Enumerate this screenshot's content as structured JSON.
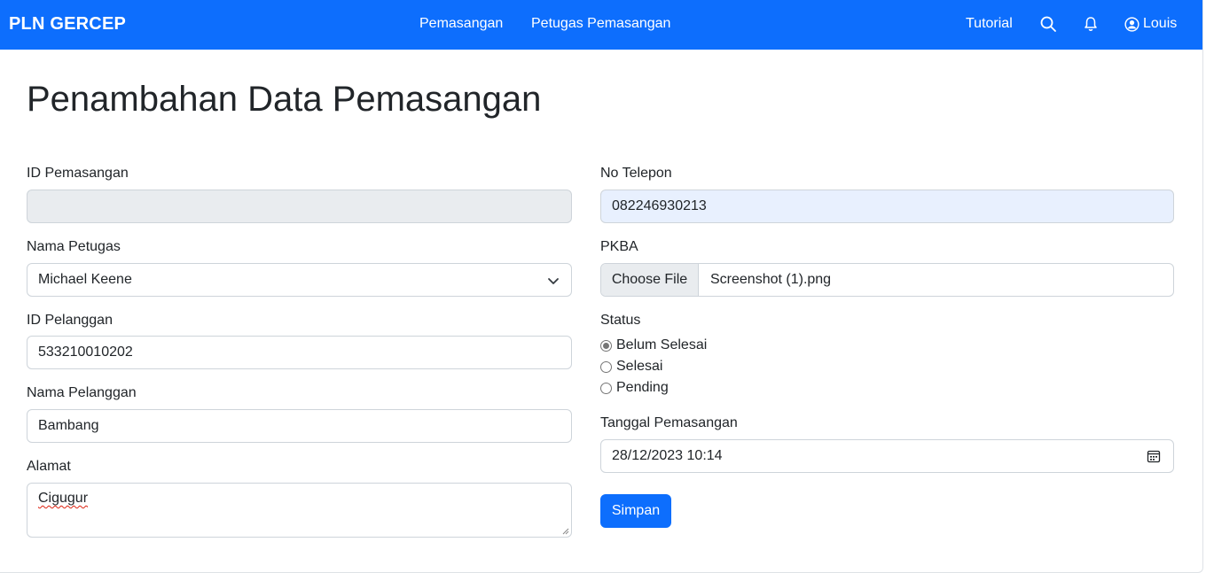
{
  "navbar": {
    "brand": "PLN GERCEP",
    "links": [
      {
        "label": "Pemasangan"
      },
      {
        "label": "Petugas Pemasangan"
      }
    ],
    "tutorial_label": "Tutorial",
    "user_name": "Louis",
    "icons": [
      "search-icon",
      "bell-icon",
      "user-circle-icon"
    ],
    "color": "#0d6efd"
  },
  "page": {
    "title": "Penambahan Data Pemasangan"
  },
  "form": {
    "id_pemasangan": {
      "label": "ID Pemasangan",
      "value": ""
    },
    "nama_petugas": {
      "label": "Nama Petugas",
      "value": "Michael Keene"
    },
    "id_pelanggan": {
      "label": "ID Pelanggan",
      "value": "533210010202"
    },
    "nama_pelanggan": {
      "label": "Nama Pelanggan",
      "value": "Bambang"
    },
    "alamat": {
      "label": "Alamat",
      "value": "Cigugur"
    },
    "no_telepon": {
      "label": "No Telepon",
      "value": "082246930213"
    },
    "pkba": {
      "label": "PKBA",
      "button_label": "Choose File",
      "file_name": "Screenshot (1).png"
    },
    "status": {
      "label": "Status",
      "options": [
        {
          "label": "Belum Selesai",
          "checked": true
        },
        {
          "label": "Selesai",
          "checked": false
        },
        {
          "label": "Pending",
          "checked": false
        }
      ]
    },
    "tanggal": {
      "label": "Tanggal Pemasangan",
      "value": "28/12/2023 10:14"
    },
    "submit_label": "Simpan"
  }
}
